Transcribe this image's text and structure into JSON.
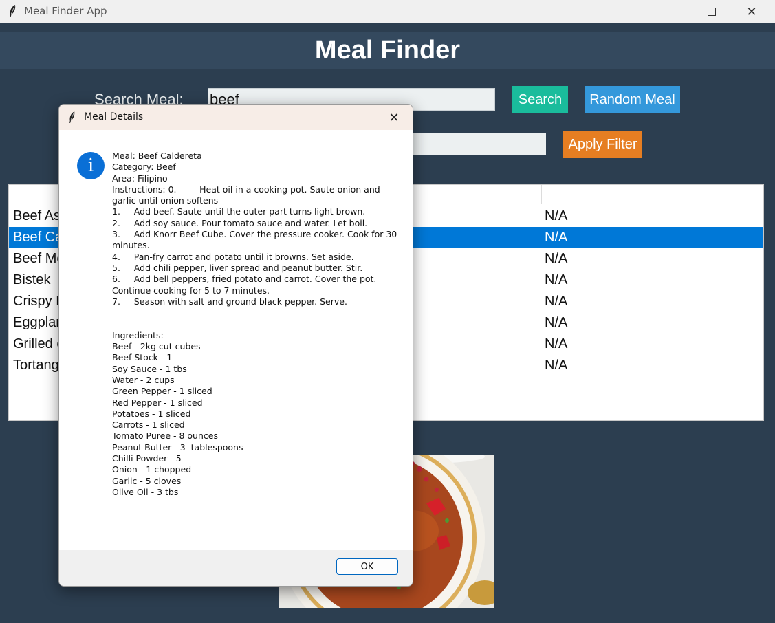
{
  "window": {
    "title": "Meal Finder App",
    "close_glyph": "✕"
  },
  "header": {
    "title": "Meal Finder"
  },
  "search": {
    "label": "Search Meal:",
    "value": "beef",
    "search_button": "Search",
    "random_button": "Random Meal"
  },
  "filter": {
    "value": "",
    "apply_button": "Apply Filter"
  },
  "table": {
    "header": {
      "name": "",
      "area": ""
    },
    "rows": [
      {
        "name": "Beef Asado",
        "area": "N/A",
        "selected": false
      },
      {
        "name": "Beef Caldereta",
        "area": "N/A",
        "selected": true
      },
      {
        "name": "Beef Mechado",
        "area": "N/A",
        "selected": false
      },
      {
        "name": "Bistek",
        "area": "N/A",
        "selected": false
      },
      {
        "name": "Crispy Beef",
        "area": "N/A",
        "selected": false
      },
      {
        "name": "Eggplant",
        "area": "N/A",
        "selected": false
      },
      {
        "name": "Grilled eggplant",
        "area": "N/A",
        "selected": false
      },
      {
        "name": "Tortang",
        "area": "N/A",
        "selected": false
      }
    ]
  },
  "dialog": {
    "title": "Meal Details",
    "close_glyph": "✕",
    "icon_glyph": "i",
    "message": "Meal: Beef Caldereta\nCategory: Beef\nArea: Filipino\nInstructions: 0.\tHeat oil in a cooking pot. Saute onion and garlic until onion softens\n1.\tAdd beef. Saute until the outer part turns light brown.\n2.\tAdd soy sauce. Pour tomato sauce and water. Let boil.\n3.\tAdd Knorr Beef Cube. Cover the pressure cooker. Cook for 30 minutes.\n4.\tPan-fry carrot and potato until it browns. Set aside.\n5.\tAdd chili pepper, liver spread and peanut butter. Stir.\n6.\tAdd bell peppers, fried potato and carrot. Cover the pot. Continue cooking for 5 to 7 minutes.\n7.\tSeason with salt and ground black pepper. Serve.\n\n\nIngredients:\nBeef - 2kg cut cubes\nBeef Stock - 1\nSoy Sauce - 1 tbs\nWater - 2 cups\nGreen Pepper - 1 sliced\nRed Pepper - 1 sliced\nPotatoes - 1 sliced\nCarrots - 1 sliced\nTomato Puree - 8 ounces\nPeanut Butter - 3  tablespoons\nChilli Powder - 5\nOnion - 1 chopped\nGarlic - 5 cloves\nOlive Oil - 3 tbs",
    "ok_label": "OK"
  },
  "icons": {
    "app": "feather-icon",
    "info": "info-icon"
  },
  "colors": {
    "background": "#2c3e50",
    "header": "#34495e",
    "search_button": "#1abc9c",
    "random_button": "#3498db",
    "filter_button": "#e67e22",
    "selection": "#0078d7",
    "info": "#0a6fd6"
  }
}
